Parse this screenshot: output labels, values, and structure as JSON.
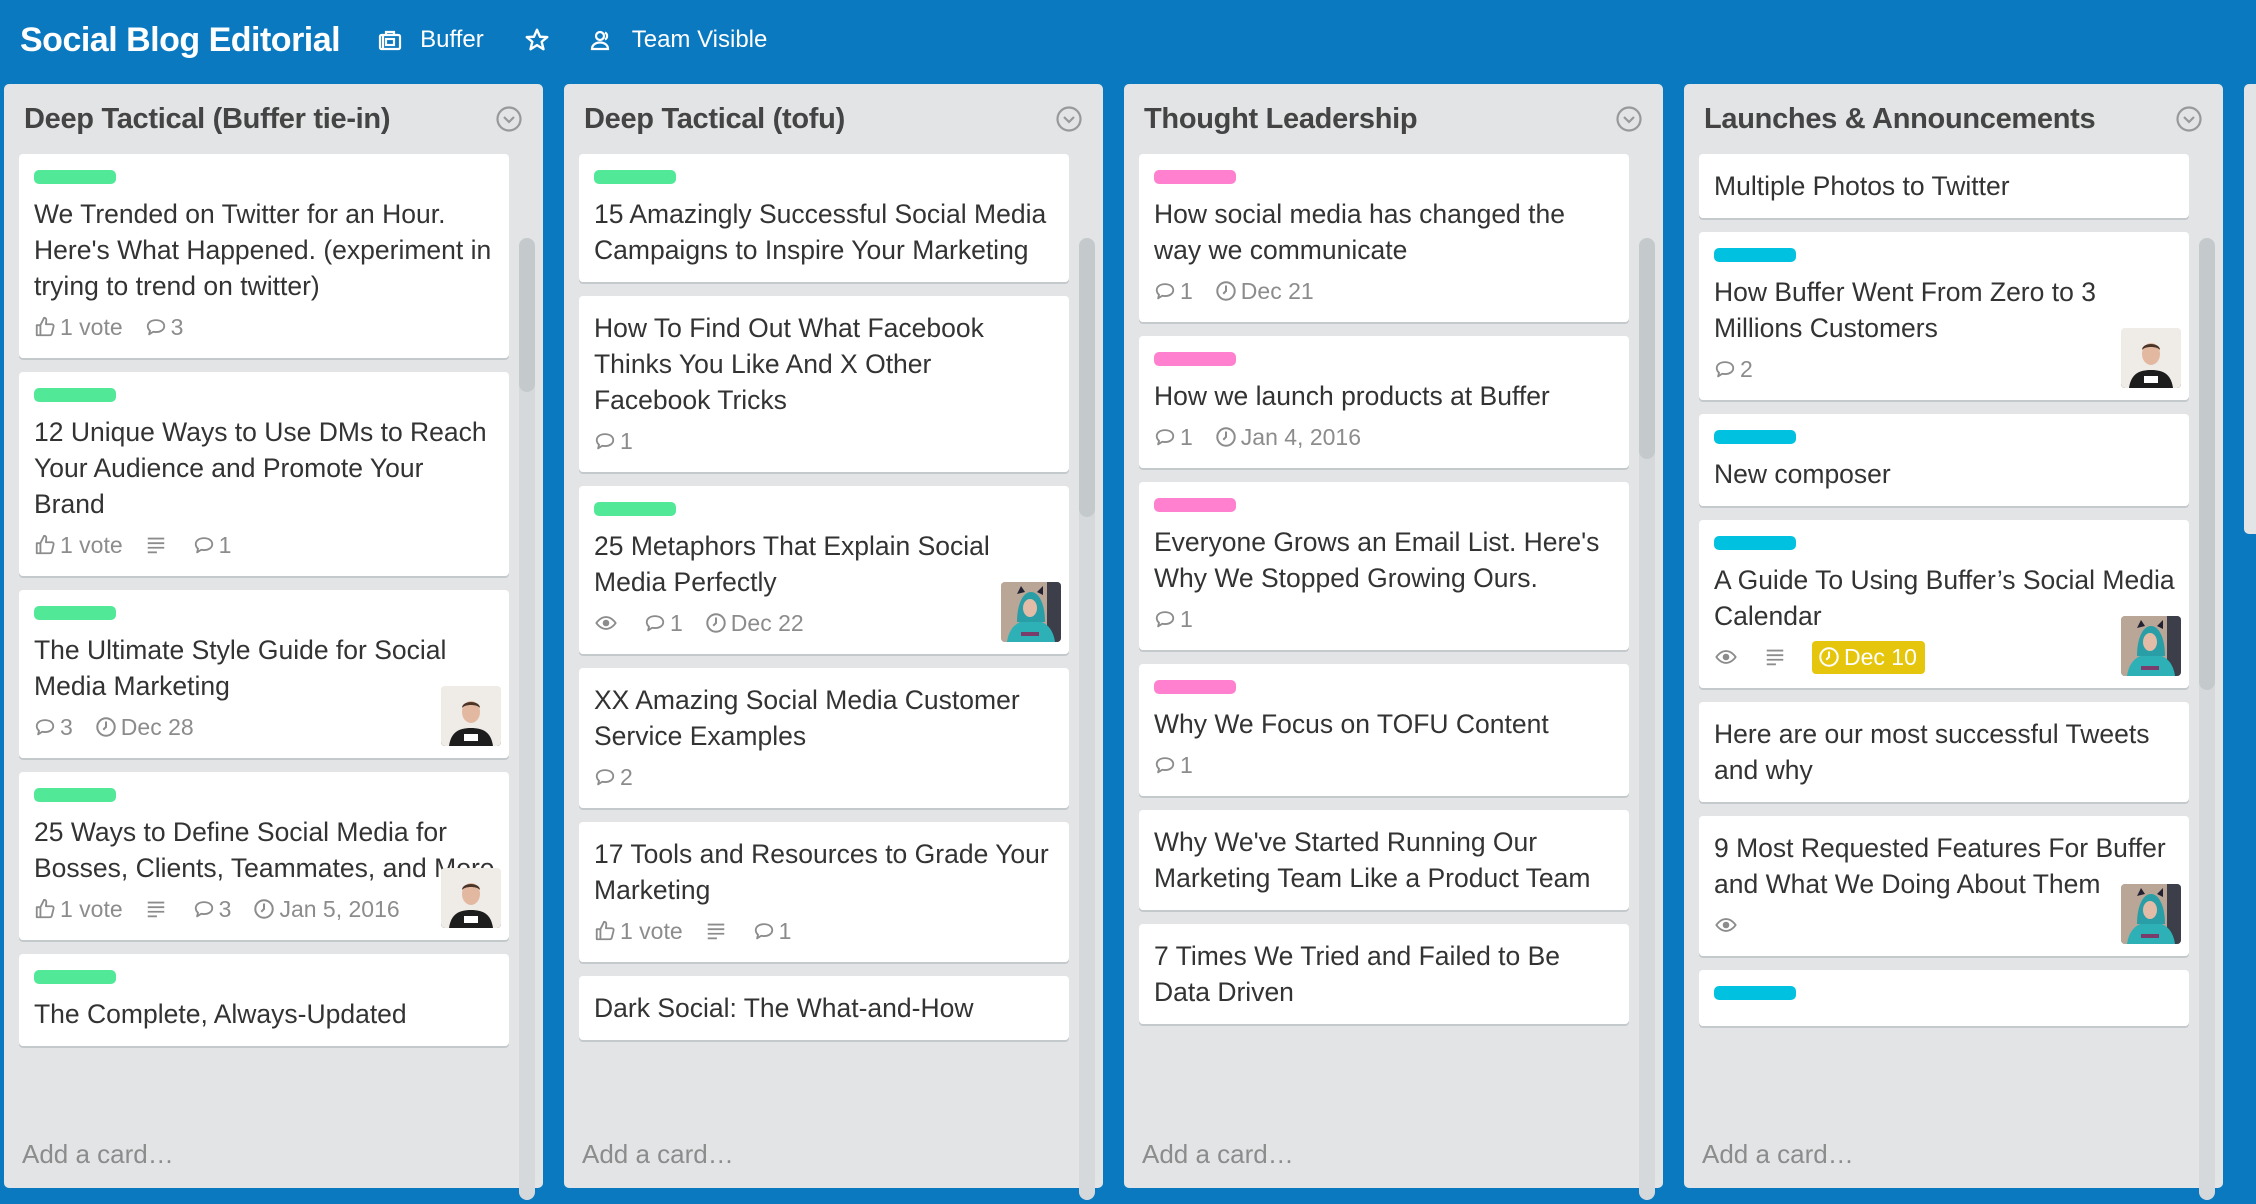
{
  "header": {
    "board_title": "Social Blog Editorial",
    "team_label": "Buffer",
    "visibility_label": "Team Visible",
    "icons": {
      "team": "briefcase-icon",
      "star": "star-icon",
      "visibility": "people-icon"
    }
  },
  "colors": {
    "board_bg": "#0a79bf",
    "label_green": "#51e898",
    "label_pink": "#ff80ce",
    "label_cyan": "#00c2e0",
    "due_soon": "#e6c60d"
  },
  "add_card_label": "Add a card…",
  "lists": [
    {
      "title": "Deep Tactical (Buffer tie-in)",
      "scroll_fraction": 0.16,
      "cards": [
        {
          "label": "green",
          "title": "We Trended on Twitter for an Hour. Here's What Happened. (experiment in trying to trend on twitter)",
          "votes": "1 vote",
          "comments": "3"
        },
        {
          "label": "green",
          "title": "12 Unique Ways to Use DMs to Reach Your Audience and Promote Your Brand",
          "votes": "1 vote",
          "description": true,
          "comments": "1"
        },
        {
          "label": "green",
          "title": "The Ultimate Style Guide for Social Media Marketing",
          "comments": "3",
          "due": "Dec 28",
          "avatar": "man"
        },
        {
          "label": "green",
          "title": "25 Ways to Define Social Media for Bosses, Clients, Teammates, and More",
          "votes": "1 vote",
          "description": true,
          "comments": "3",
          "due": "Jan 5, 2016",
          "avatar": "man"
        },
        {
          "label": "green",
          "title": "The Complete, Always-Updated"
        }
      ]
    },
    {
      "title": "Deep Tactical (tofu)",
      "scroll_fraction": 0.29,
      "cards": [
        {
          "label": "green",
          "title": "15 Amazingly Successful Social Media Campaigns to Inspire Your Marketing"
        },
        {
          "title": "How To Find Out What Facebook Thinks You Like And X Other Facebook Tricks",
          "comments": "1"
        },
        {
          "label": "green",
          "title": "25 Metaphors That Explain Social Media Perfectly",
          "watching": true,
          "comments": "1",
          "due": "Dec 22",
          "avatar": "woman"
        },
        {
          "title": "XX Amazing Social Media Customer Service Examples",
          "comments": "2"
        },
        {
          "title": "17 Tools and Resources to Grade Your Marketing",
          "votes": "1 vote",
          "description": true,
          "comments": "1"
        },
        {
          "title": "Dark Social: The What-and-How"
        }
      ]
    },
    {
      "title": "Thought Leadership",
      "scroll_fraction": 0.23,
      "cards": [
        {
          "label": "pink",
          "title": "How social media has changed the way we communicate",
          "comments": "1",
          "due": "Dec 21"
        },
        {
          "label": "pink",
          "title": "How we launch products at Buffer",
          "comments": "1",
          "due": "Jan 4, 2016"
        },
        {
          "label": "pink",
          "title": "Everyone Grows an Email List. Here's Why We Stopped Growing Ours.",
          "comments": "1"
        },
        {
          "label": "pink",
          "title": "Why We Focus on TOFU Content",
          "comments": "1"
        },
        {
          "title": "Why We've Started Running Our Marketing Team Like a Product Team"
        },
        {
          "title": "7 Times We Tried and Failed to Be Data Driven"
        }
      ]
    },
    {
      "title": "Launches & Announcements",
      "scroll_fraction": 0.47,
      "cards": [
        {
          "title": "Multiple Photos to Twitter"
        },
        {
          "label": "cyan",
          "title": "How Buffer Went From Zero to 3 Millions Customers",
          "comments": "2",
          "avatar": "man"
        },
        {
          "label": "cyan",
          "title": "New composer"
        },
        {
          "label": "cyan",
          "title": "A Guide To Using Buffer’s Social Media Calendar",
          "watching": true,
          "description": true,
          "due": "Dec 10",
          "due_soon": true,
          "avatar": "woman"
        },
        {
          "title": "Here are our most successful Tweets and why"
        },
        {
          "title": "9 Most Requested Features For Buffer and What We Doing About Them",
          "watching": true,
          "avatar": "woman"
        },
        {
          "label": "cyan",
          "title": ""
        }
      ]
    }
  ]
}
